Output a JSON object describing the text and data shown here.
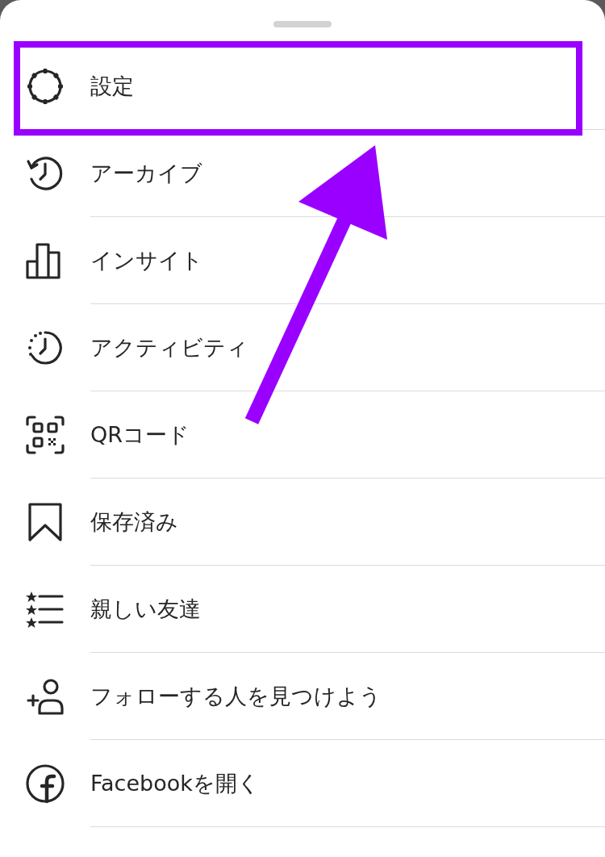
{
  "menu": [
    {
      "kind": "settings",
      "label": "設定",
      "highlighted": true
    },
    {
      "kind": "archive",
      "label": "アーカイブ",
      "highlighted": false
    },
    {
      "kind": "insights",
      "label": "インサイト",
      "highlighted": false
    },
    {
      "kind": "activity",
      "label": "アクティビティ",
      "highlighted": false
    },
    {
      "kind": "qr",
      "label": "QRコード",
      "highlighted": false
    },
    {
      "kind": "saved",
      "label": "保存済み",
      "highlighted": false
    },
    {
      "kind": "friends",
      "label": "親しい友達",
      "highlighted": false
    },
    {
      "kind": "follow",
      "label": "フォローする人を見つけよう",
      "highlighted": false
    },
    {
      "kind": "facebook",
      "label": "Facebookを開く",
      "highlighted": false
    }
  ]
}
